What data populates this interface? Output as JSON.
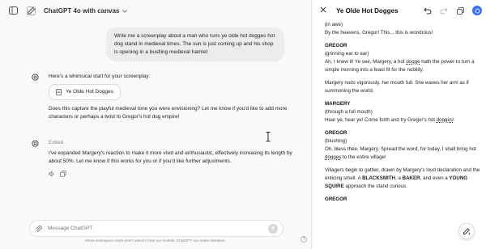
{
  "header": {
    "title": "ChatGPT 4o with canvas"
  },
  "conversation": {
    "user_message": "Write me a screenplay about a man who runs ye olde hot dogges hot dog stand in medieval times. The sun is just coming up and his shop is opening in a bustling medieval hamlet",
    "assistant_1": {
      "intro": "Here's a whimsical start for your screenplay:",
      "doc_chip": "Ye Olde Hot Dogges",
      "followup": "Does this capture the playful medieval tone you were envisioning? Let me know if you'd like to add more characters or perhaps a twist to Gregor's hot dog empire!"
    },
    "assistant_2": {
      "edited_label": "Edited",
      "text": "I've expanded Margery's reaction to make it more vivid and enthusiastic, effectively increasing its length by about 50%. Let me know if this works for you or if you'd like further adjustments."
    }
  },
  "composer": {
    "placeholder": "Message ChatGPT"
  },
  "disclaimer": "Mesa workspace chats aren't used to train our models. ChatGPT can make mistakes.",
  "help_label": "?",
  "canvas": {
    "title": "Ye Olde Hot Dogges",
    "script": {
      "l1": "(in awe)",
      "l2": "By the heavens, Gregor! This... this is wondrous!",
      "c1": "GREGOR",
      "l3": "(grinning ear to ear)",
      "l4a": "Ah, I knew it! Ye see, Margery, a hot ",
      "l4u": "dogge",
      "l4b": " hath the power to turn a simple morning into a feast fit for the nobility.",
      "l5": "Margery nods vigorously, her mouth full. She waves her arm as if summoning the world.",
      "c2": "MARGERY",
      "l6": "(through a full mouth)",
      "l7a": "Hear ye, hear ye! Come forth and try Gregor's hot ",
      "l7u": "dogges",
      "l7b": "!",
      "c3": "GREGOR",
      "l8": "(blushing)",
      "l9a": "Oh, bless thee, Margery. Spread the word, for today, I shall bring hot ",
      "l9u": "dogges",
      "l9b": " to the entire village!",
      "l10a": "Villagers begin to gather, drawn by Margery's loud declaration and the enticing smell. A ",
      "l10b1": "BLACKSMITH",
      "l10c": ", a ",
      "l10b2": "BAKER",
      "l10d": ", and even a ",
      "l10b3": "YOUNG SQUIRE",
      "l10e": " approach the stand curious.",
      "l11": "GREGOR"
    }
  },
  "colors": {
    "accent": "#3b6cf5",
    "chat_bg": "#f9f9f9",
    "bubble": "#ececec"
  }
}
